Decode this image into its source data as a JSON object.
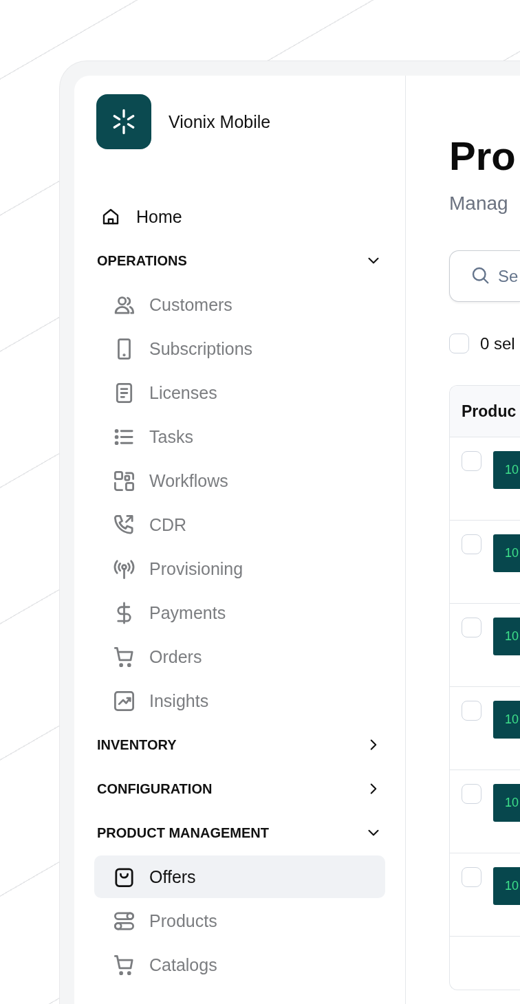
{
  "sidebar": {
    "brand": "Vionix Mobile",
    "items": [
      {
        "label": "Home",
        "selected": false
      }
    ],
    "sections": [
      {
        "title": "OPERATIONS",
        "expanded": true,
        "items": [
          {
            "label": "Customers",
            "selected": false
          },
          {
            "label": "Subscriptions",
            "selected": false
          },
          {
            "label": "Licenses",
            "selected": false
          },
          {
            "label": "Tasks",
            "selected": false
          },
          {
            "label": "Workflows",
            "selected": false
          },
          {
            "label": "CDR",
            "selected": false
          },
          {
            "label": "Provisioning",
            "selected": false
          },
          {
            "label": "Payments",
            "selected": false
          },
          {
            "label": "Orders",
            "selected": false
          },
          {
            "label": "Insights",
            "selected": false
          }
        ]
      },
      {
        "title": "INVENTORY",
        "expanded": false
      },
      {
        "title": "CONFIGURATION",
        "expanded": false
      },
      {
        "title": "PRODUCT MANAGEMENT",
        "expanded": true,
        "items": [
          {
            "label": "Offers",
            "selected": true
          },
          {
            "label": "Products",
            "selected": false
          },
          {
            "label": "Catalogs",
            "selected": false
          }
        ]
      }
    ]
  },
  "main": {
    "title": "Pro",
    "subtitle": "Manag",
    "search": {
      "placeholder": "Se"
    },
    "selection": {
      "checked": false,
      "label": "0 sel"
    },
    "table": {
      "columns": [
        "Produc"
      ],
      "rows": [
        {
          "checked": false,
          "thumb": "10"
        },
        {
          "checked": false,
          "thumb": "10"
        },
        {
          "checked": false,
          "thumb": "10"
        },
        {
          "checked": false,
          "thumb": "10"
        },
        {
          "checked": false,
          "thumb": "10"
        },
        {
          "checked": false,
          "thumb": "10"
        }
      ]
    }
  }
}
